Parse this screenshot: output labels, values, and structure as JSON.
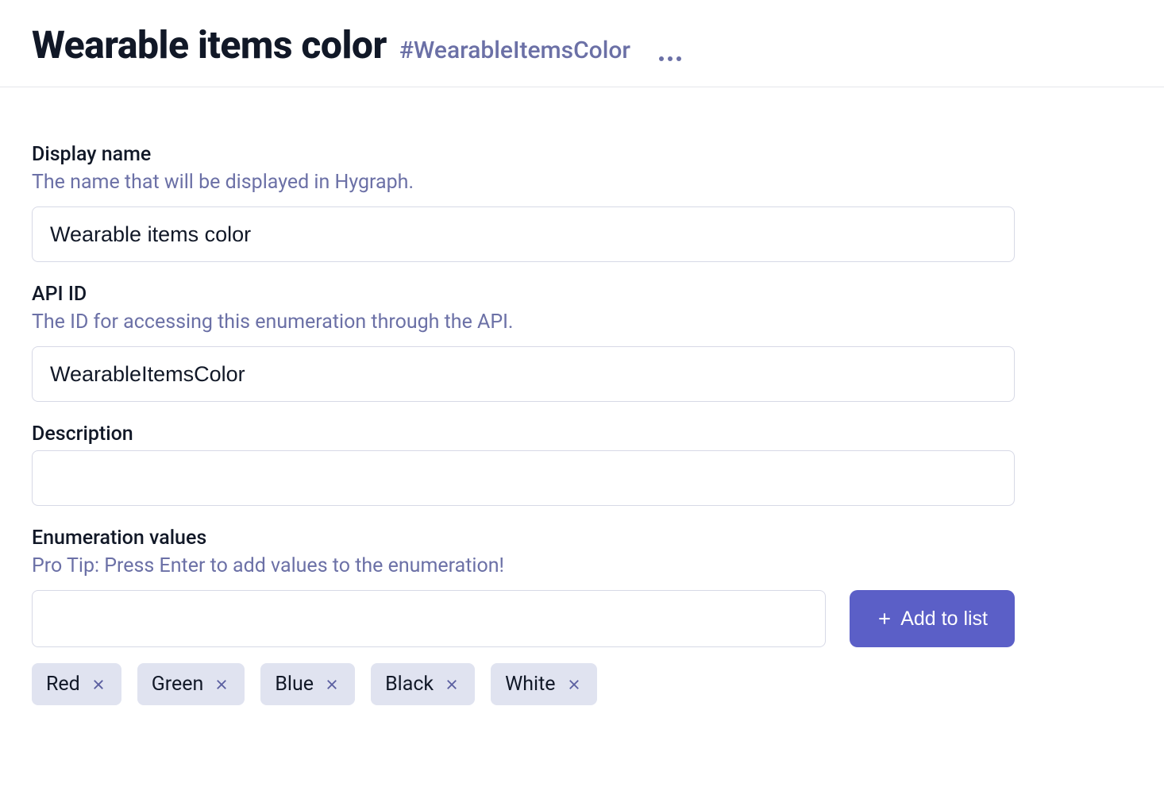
{
  "header": {
    "title": "Wearable items color",
    "hash": "#WearableItemsColor"
  },
  "fields": {
    "display_name": {
      "label": "Display name",
      "help": "The name that will be displayed in Hygraph.",
      "value": "Wearable items color"
    },
    "api_id": {
      "label": "API ID",
      "help": "The ID for accessing this enumeration through the API.",
      "value": "WearableItemsColor"
    },
    "description": {
      "label": "Description",
      "value": ""
    },
    "enum": {
      "label": "Enumeration values",
      "help": "Pro Tip: Press Enter to add values to the enumeration!",
      "input_value": "",
      "add_button": "Add to list",
      "values": [
        "Red",
        "Green",
        "Blue",
        "Black",
        "White"
      ]
    }
  }
}
